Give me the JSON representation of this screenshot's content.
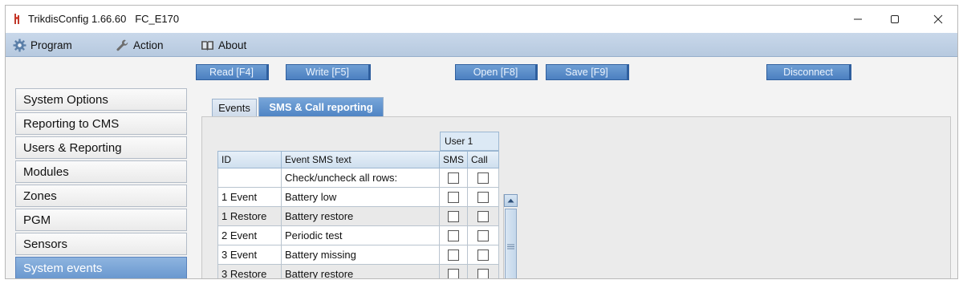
{
  "window": {
    "title": "TrikdisConfig 1.66.60   FC_E170"
  },
  "menu": {
    "items": [
      {
        "label": "Program",
        "icon": "gear-icon"
      },
      {
        "label": "Action",
        "icon": "wrench-icon"
      },
      {
        "label": "About",
        "icon": "book-icon"
      }
    ]
  },
  "toolbar": {
    "read": "Read [F4]",
    "write": "Write [F5]",
    "open": "Open [F8]",
    "save": "Save [F9]",
    "disconnect": "Disconnect"
  },
  "sidebar": {
    "items": [
      {
        "label": "System Options"
      },
      {
        "label": "Reporting to CMS"
      },
      {
        "label": "Users & Reporting"
      },
      {
        "label": "Modules"
      },
      {
        "label": "Zones"
      },
      {
        "label": "PGM"
      },
      {
        "label": "Sensors"
      },
      {
        "label": "System events",
        "selected": true
      }
    ]
  },
  "tabs": {
    "events": "Events",
    "sms_call": "SMS & Call reporting"
  },
  "grid": {
    "group_header": "User 1",
    "columns": [
      "ID",
      "Event SMS text",
      "SMS",
      "Call"
    ],
    "check_all_label": "Check/uncheck all rows:",
    "rows": [
      {
        "id": "1 Event",
        "text": "Battery low",
        "sms": false,
        "call": false
      },
      {
        "id": "1 Restore",
        "text": "Battery restore",
        "sms": false,
        "call": false
      },
      {
        "id": "2 Event",
        "text": "Periodic test",
        "sms": false,
        "call": false
      },
      {
        "id": "3 Event",
        "text": "Battery missing",
        "sms": false,
        "call": false
      },
      {
        "id": "3 Restore",
        "text": "Battery restore",
        "sms": false,
        "call": false
      }
    ]
  },
  "colors": {
    "accent": "#4f84c4",
    "menubar": "#c9d8ea",
    "selected_sidebar": "#6a98cf"
  }
}
